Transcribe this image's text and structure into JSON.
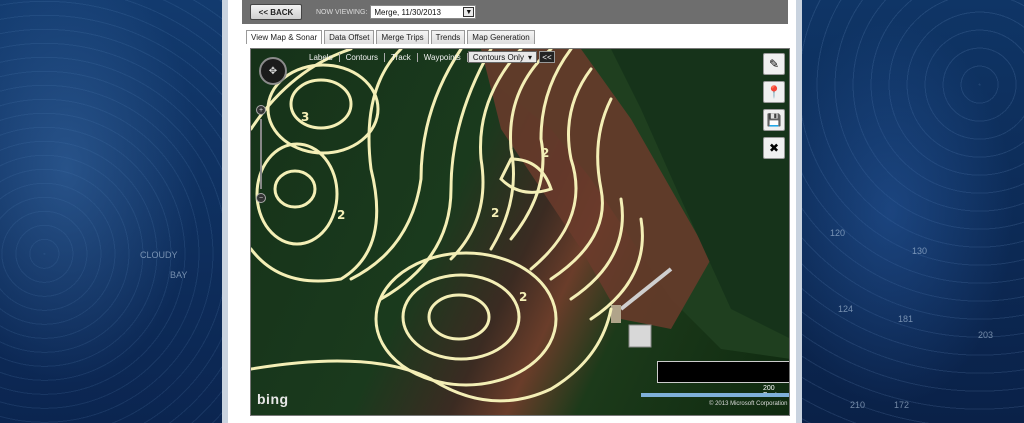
{
  "topbar": {
    "back_label": "<< BACK",
    "viewing_label": "NOW VIEWING:",
    "viewing_value": "Merge, 11/30/2013"
  },
  "tabs": [
    {
      "label": "View Map & Sonar"
    },
    {
      "label": "Data Offset"
    },
    {
      "label": "Merge Trips"
    },
    {
      "label": "Trends"
    },
    {
      "label": "Map Generation"
    }
  ],
  "map_toolbar": {
    "labels": "Labels",
    "contours": "Contours",
    "track": "Track",
    "waypoints": "Waypoints",
    "contours_select": "Contours Only",
    "collapse": "<<"
  },
  "map": {
    "scale_label": "200 Feet",
    "copyright": "© 2013 Microsoft Corporation",
    "logo": "bing"
  },
  "background": {
    "chart_labels": [
      "CLOUDY",
      "BAY",
      "120",
      "130",
      "124",
      "181",
      "172",
      "203",
      "210"
    ]
  },
  "icons": {
    "side_tools": [
      "edit-note-icon",
      "marker-icon",
      "save-icon",
      "delete-icon"
    ]
  },
  "colors": {
    "contour": "#f4efb6",
    "topbar": "#6e6e6e",
    "scale": "#7fb0da"
  }
}
